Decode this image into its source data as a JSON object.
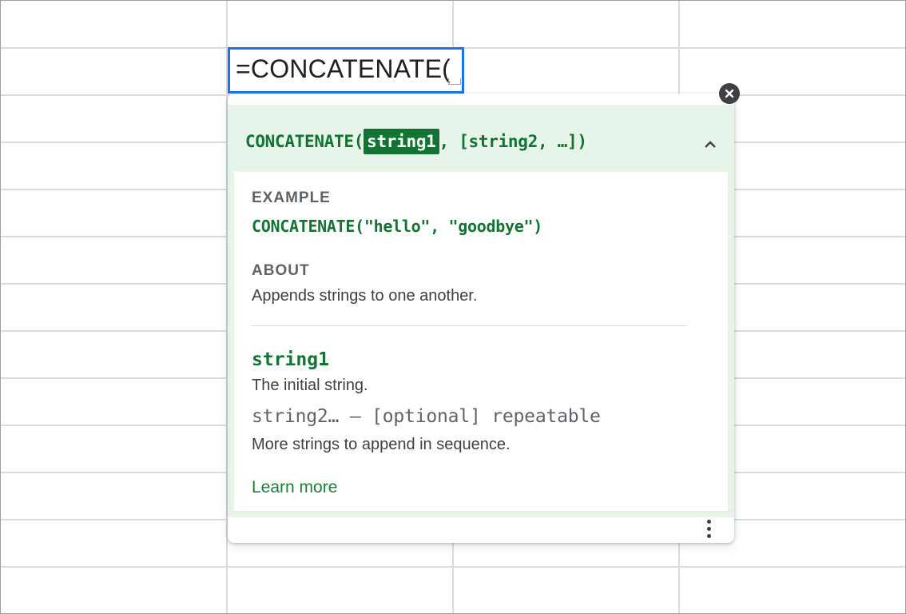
{
  "editor": {
    "formula_text": "=CONCATENATE("
  },
  "popup": {
    "signature": {
      "func_open": "CONCATENATE(",
      "active_param": "string1",
      "rest": ", [string2, …])"
    },
    "example": {
      "label": "EXAMPLE",
      "code": "CONCATENATE(\"hello\", \"goodbye\")"
    },
    "about": {
      "label": "ABOUT",
      "text": "Appends strings to one another."
    },
    "params": [
      {
        "name": "string1",
        "description": "The initial string."
      },
      {
        "name": "string2… – [optional] repeatable",
        "description": "More strings to append in sequence."
      }
    ],
    "learn_more": "Learn more",
    "icons": {
      "collapse": "chevron-up-icon",
      "close": "close-icon",
      "more": "more-vert-icon"
    }
  },
  "colors": {
    "accent_green": "#137333",
    "header_bg": "#e6f4ea",
    "selection_blue": "#1a73e8"
  }
}
